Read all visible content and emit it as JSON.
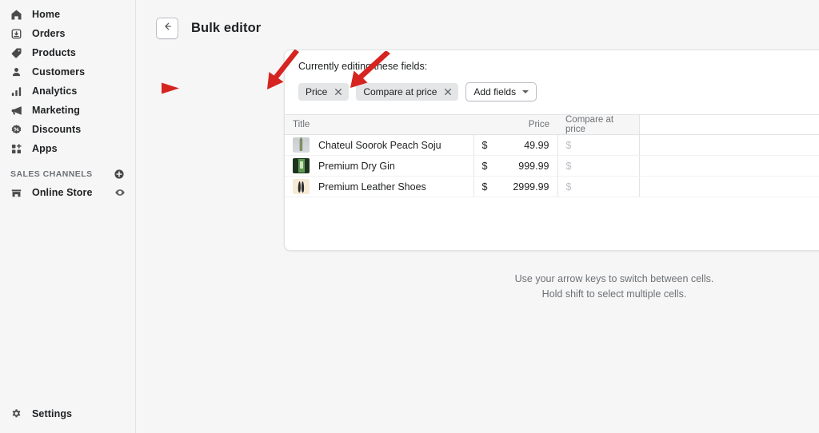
{
  "sidebar": {
    "items": [
      {
        "label": "Home",
        "icon": "home-icon"
      },
      {
        "label": "Orders",
        "icon": "orders-icon"
      },
      {
        "label": "Products",
        "icon": "products-tag-icon"
      },
      {
        "label": "Customers",
        "icon": "customers-person-icon"
      },
      {
        "label": "Analytics",
        "icon": "analytics-bars-icon"
      },
      {
        "label": "Marketing",
        "icon": "marketing-megaphone-icon"
      },
      {
        "label": "Discounts",
        "icon": "discounts-badge-icon"
      },
      {
        "label": "Apps",
        "icon": "apps-grid-icon"
      }
    ],
    "sales_channels": {
      "title": "SALES CHANNELS",
      "add_icon": "plus-circle-icon",
      "channels": [
        {
          "label": "Online Store",
          "icon": "storefront-icon",
          "trailing_icon": "eye-icon"
        }
      ]
    },
    "settings": {
      "label": "Settings",
      "icon": "gear-icon"
    }
  },
  "topbar": {
    "back_icon": "arrow-left-icon",
    "title": "Bulk editor"
  },
  "fields": {
    "label": "Currently editing these fields:",
    "chips": [
      {
        "label": "Price",
        "remove_icon": "close-icon"
      },
      {
        "label": "Compare at price",
        "remove_icon": "close-icon"
      }
    ],
    "add_button": {
      "label": "Add fields",
      "icon": "chevron-down-icon"
    }
  },
  "table": {
    "columns": [
      {
        "key": "title",
        "label": "Title",
        "align": "left"
      },
      {
        "key": "price",
        "label": "Price",
        "align": "right"
      },
      {
        "key": "compare_at_price",
        "label": "Compare at price",
        "align": "left"
      }
    ],
    "currency_symbol": "$",
    "rows": [
      {
        "title": "Chateul Soorok Peach Soju",
        "price": "49.99",
        "compare_at_price": "",
        "thumb_colors": [
          "#c9cdd0",
          "#7e8f63"
        ]
      },
      {
        "title": "Premium Dry Gin",
        "price": "999.99",
        "compare_at_price": "",
        "thumb_colors": [
          "#1d3320",
          "#5e9a52"
        ]
      },
      {
        "title": "Premium Leather Shoes",
        "price": "2999.99",
        "compare_at_price": "",
        "thumb_colors": [
          "#f6ead7",
          "#2b2b2b"
        ]
      }
    ]
  },
  "hint": {
    "line1": "Use your arrow keys to switch between cells.",
    "line2": "Hold shift to select multiple cells."
  },
  "annotations": {
    "color": "#d62420",
    "arrows": [
      {
        "name": "arrow-pointing-to-price-chip",
        "target": "Price chip"
      },
      {
        "name": "arrow-pointing-to-compare-at-price-chip",
        "target": "Compare at price chip"
      },
      {
        "name": "arrow-pointing-to-add-fields-button",
        "target": "Add fields button"
      }
    ]
  },
  "colors": {
    "page_bg": "#f6f6f7",
    "card_bg": "#ffffff",
    "border": "#e1e3e5",
    "text": "#202223",
    "muted_text": "#6d7175",
    "annotation_red": "#d62420"
  }
}
